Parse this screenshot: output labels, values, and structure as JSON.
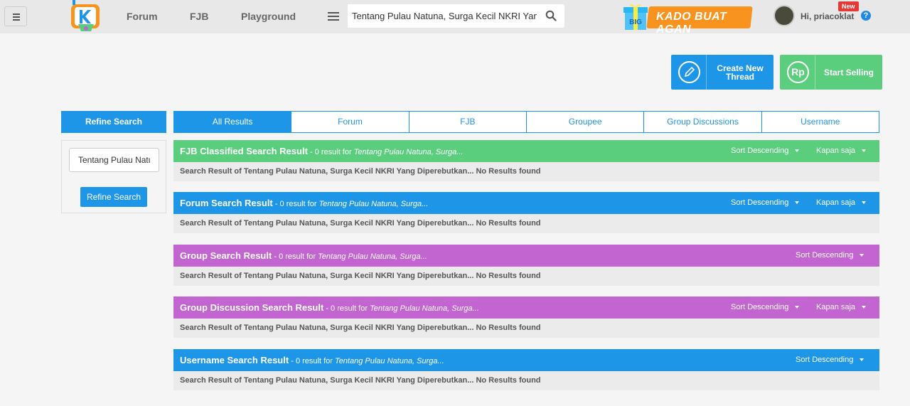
{
  "header": {
    "nav": [
      "Forum",
      "FJB",
      "Playground"
    ],
    "search_value": "Tentang Pulau Natuna, Surga Kecil NKRI Yang",
    "promo_badge": "BIG",
    "promo_text": "KADO BUAT AGAN",
    "user_greeting": "Hi, priacoklat",
    "new_badge": "New",
    "help": "?"
  },
  "actions": {
    "create_line1": "Create New",
    "create_line2": "Thread",
    "sell_label": "Start Selling",
    "sell_icon": "Rp"
  },
  "refine": {
    "heading": "Refine Search",
    "input_value": "Tentang Pulau Natu",
    "button": "Refine Search"
  },
  "tabs": [
    "All Results",
    "Forum",
    "FJB",
    "Groupee",
    "Group Discussions",
    "Username"
  ],
  "sections": [
    {
      "title": "FJB Classified Search Result",
      "count": " - 0 result for ",
      "query": "Tentang Pulau Natuna, Surga...",
      "sort": "Sort Descending",
      "time": "Kapan saja",
      "body": "Search Result of Tentang Pulau Natuna, Surga Kecil NKRI Yang Diperebutkan... No Results found",
      "color": "#5bce7e"
    },
    {
      "title": "Forum Search Result",
      "count": " - 0 result for ",
      "query": "Tentang Pulau Natuna, Surga...",
      "sort": "Sort Descending",
      "time": "Kapan saja",
      "body": "Search Result of Tentang Pulau Natuna, Surga Kecil NKRI Yang Diperebutkan... No Results found",
      "color": "#1e96e8"
    },
    {
      "title": "Group Search Result",
      "count": " - 0 result for ",
      "query": "Tentang Pulau Natuna, Surga...",
      "sort": "Sort Descending",
      "time": "",
      "body": "Search Result of Tentang Pulau Natuna, Surga Kecil NKRI Yang Diperebutkan... No Results found",
      "color": "#c265d0"
    },
    {
      "title": "Group Discussion Search Result",
      "count": " - 0 result for ",
      "query": "Tentang Pulau Natuna, Surga...",
      "sort": "Sort Descending",
      "time": "Kapan saja",
      "body": "Search Result of Tentang Pulau Natuna, Surga Kecil NKRI Yang Diperebutkan... No Results found",
      "color": "#c265d0"
    },
    {
      "title": "Username Search Result",
      "count": " - 0 result for ",
      "query": "Tentang Pulau Natuna, Surga...",
      "sort": "Sort Descending",
      "time": "",
      "body": "Search Result of Tentang Pulau Natuna, Surga Kecil NKRI Yang Diperebutkan... No Results found",
      "color": "#1e96e8"
    }
  ]
}
